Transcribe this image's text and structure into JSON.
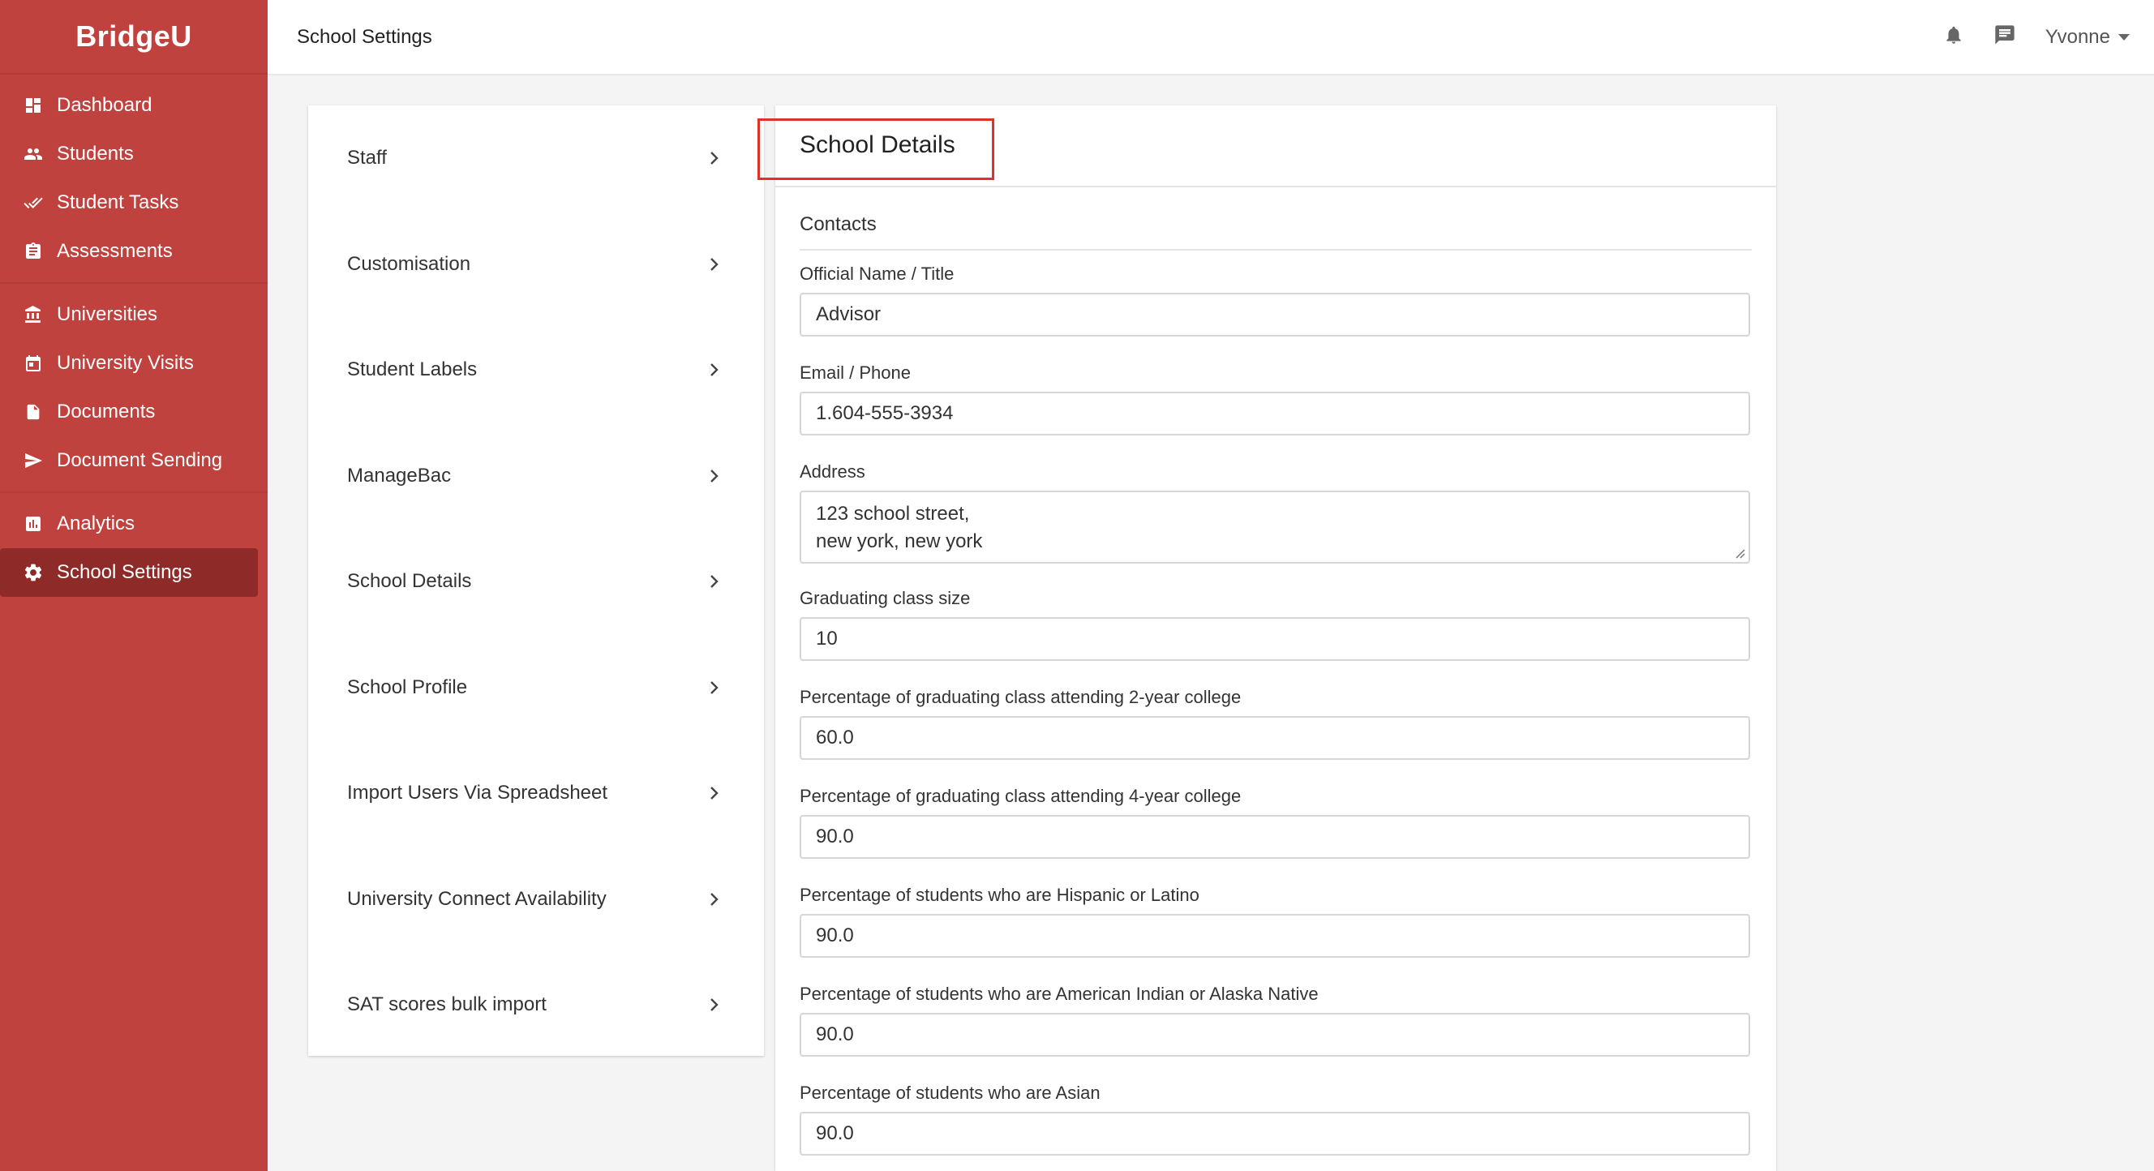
{
  "app": {
    "logo": "BridgeU"
  },
  "sidebar": {
    "groups": [
      [
        {
          "label": "Dashboard",
          "icon": "dashboard-icon"
        },
        {
          "label": "Students",
          "icon": "people-icon"
        },
        {
          "label": "Student Tasks",
          "icon": "double-check-icon"
        },
        {
          "label": "Assessments",
          "icon": "clipboard-icon"
        }
      ],
      [
        {
          "label": "Universities",
          "icon": "institution-icon"
        },
        {
          "label": "University Visits",
          "icon": "calendar-icon"
        },
        {
          "label": "Documents",
          "icon": "document-icon"
        },
        {
          "label": "Document Sending",
          "icon": "send-icon"
        }
      ],
      [
        {
          "label": "Analytics",
          "icon": "chart-icon"
        },
        {
          "label": "School Settings",
          "icon": "gear-icon",
          "active": true
        }
      ]
    ]
  },
  "header": {
    "title": "School Settings",
    "user": "Yvonne"
  },
  "settings_menu": [
    "Staff",
    "Customisation",
    "Student Labels",
    "ManageBac",
    "School Details",
    "School Profile",
    "Import Users Via Spreadsheet",
    "University Connect Availability",
    "SAT scores bulk import"
  ],
  "details": {
    "title": "School Details",
    "section": "Contacts",
    "fields": {
      "official_name": {
        "label": "Official Name / Title",
        "value": "Advisor"
      },
      "email_phone": {
        "label": "Email / Phone",
        "value": "1.604-555-3934"
      },
      "address": {
        "label": "Address",
        "value": "123 school street,\nnew york, new york"
      },
      "class_size": {
        "label": "Graduating class size",
        "value": "10"
      },
      "pct_2yr": {
        "label": "Percentage of graduating class attending 2-year college",
        "value": "60.0"
      },
      "pct_4yr": {
        "label": "Percentage of graduating class attending 4-year college",
        "value": "90.0"
      },
      "pct_hispanic": {
        "label": "Percentage of students who are Hispanic or Latino",
        "value": "90.0"
      },
      "pct_native": {
        "label": "Percentage of students who are American Indian or Alaska Native",
        "value": "90.0"
      },
      "pct_asian": {
        "label": "Percentage of students who are Asian",
        "value": "90.0"
      }
    }
  },
  "colors": {
    "sidebar": "#c0423f",
    "sidebar_active": "#8e2a28",
    "highlight": "#e0312b"
  }
}
